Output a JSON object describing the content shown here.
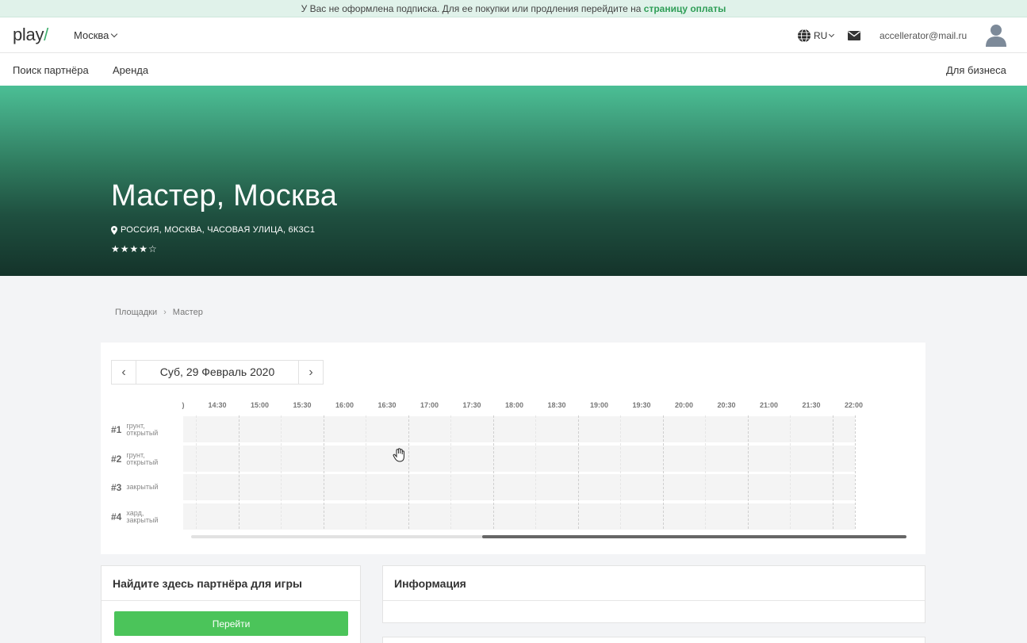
{
  "banner": {
    "text": "У Вас не оформлена подписка. Для ее покупки или продления перейдите на ",
    "link": "страницу оплаты"
  },
  "header": {
    "logo_main": "play",
    "logo_slash": "/",
    "city": "Москва",
    "lang": "RU",
    "email": "accellerator@mail.ru"
  },
  "nav": {
    "partner_search": "Поиск партнёра",
    "rent": "Аренда",
    "business": "Для бизнеса"
  },
  "hero": {
    "title": "Мастер, Москва",
    "address": "РОССИЯ, МОСКВА, ЧАСОВАЯ УЛИЦА, 6К3С1",
    "stars": "★★★★☆",
    "rating": 4
  },
  "breadcrumb": {
    "root": "Площадки",
    "sep": "›",
    "current": "Мастер"
  },
  "schedule": {
    "prev": "‹",
    "next": "›",
    "date": "Суб, 29 Февраль 2020",
    "cut_label": ")",
    "times": [
      "14:30",
      "15:00",
      "15:30",
      "16:00",
      "16:30",
      "17:00",
      "17:30",
      "18:00",
      "18:30",
      "19:00",
      "19:30",
      "20:00",
      "20:30",
      "21:00",
      "21:30",
      "22:00"
    ],
    "courts": [
      {
        "num": "#1",
        "type_line1": "грунт,",
        "type_line2": "открытый"
      },
      {
        "num": "#2",
        "type_line1": "грунт,",
        "type_line2": "открытый"
      },
      {
        "num": "#3",
        "type_line1": "закрытый",
        "type_line2": ""
      },
      {
        "num": "#4",
        "type_line1": "хард,",
        "type_line2": "закрытый"
      }
    ]
  },
  "partner_card": {
    "title": "Найдите здесь партнёра для игры",
    "button": "Перейти"
  },
  "info_card": {
    "title": "Информация"
  },
  "colors": {
    "accent": "#4bc45a",
    "banner_link": "#2f9e57",
    "hero_top": "#4bbf95",
    "hero_bottom": "#14332a"
  }
}
